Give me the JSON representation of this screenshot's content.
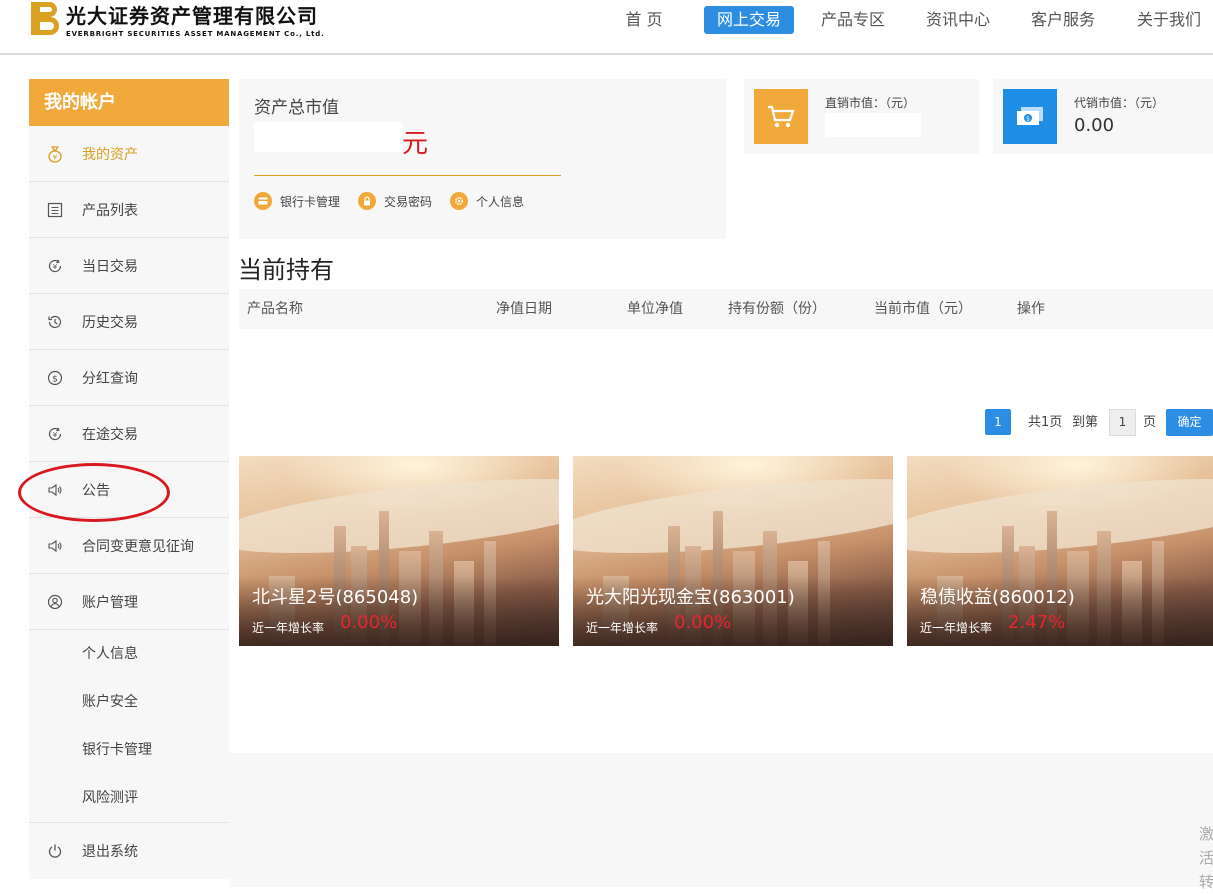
{
  "header": {
    "logo_cn": "光大证券资产管理有限公司",
    "logo_en": "EVERBRIGHT SECURITIES ASSET MANAGEMENT Co., Ltd.",
    "nav": [
      "首 页",
      "网上交易",
      "产品专区",
      "资讯中心",
      "客户服务",
      "关于我们"
    ],
    "active_nav": "网上交易",
    "accent_color": "#2d8de3"
  },
  "sidebar": {
    "title": "我的帐户",
    "title_color": "#f2a93b",
    "items": [
      {
        "label": "我的资产",
        "icon": "moneybag-icon",
        "active": true
      },
      {
        "label": "产品列表",
        "icon": "list-icon"
      },
      {
        "label": "当日交易",
        "icon": "yuan-refresh-icon"
      },
      {
        "label": "历史交易",
        "icon": "history-icon"
      },
      {
        "label": "分红查询",
        "icon": "dollar-circle-icon"
      },
      {
        "label": "在途交易",
        "icon": "yuan-refresh-icon"
      },
      {
        "label": "公告",
        "icon": "speaker-icon"
      },
      {
        "label": "合同变更意见征询",
        "icon": "speaker-icon"
      },
      {
        "label": "账户管理",
        "icon": "user-circle-icon"
      }
    ],
    "sub_items": [
      "个人信息",
      "账户安全",
      "银行卡管理",
      "风险测评"
    ],
    "logout": {
      "label": "退出系统",
      "icon": "power-icon"
    }
  },
  "assets": {
    "title": "资产总市值",
    "unit": "元",
    "links": [
      {
        "label": "银行卡管理",
        "icon": "card-icon"
      },
      {
        "label": "交易密码",
        "icon": "lock-icon"
      },
      {
        "label": "个人信息",
        "icon": "gear-icon"
      }
    ],
    "direct": {
      "label": "直销市值：（元）",
      "icon": "cart-icon"
    },
    "agency": {
      "label": "代销市值：（元）",
      "value": "0.00",
      "icon": "cash-icon"
    }
  },
  "holdings": {
    "title": "当前持有",
    "columns": [
      "产品名称",
      "净值日期",
      "单位净值",
      "持有份额（份）",
      "当前市值（元）",
      "操作"
    ]
  },
  "pager": {
    "current": "1",
    "total_text": "共1页",
    "goto_text": "到第",
    "goto_value": "1",
    "page_suffix": "页",
    "confirm": "确定"
  },
  "products": [
    {
      "name": "北斗星2号(865048)",
      "rate_label": "近一年增长率",
      "rate": "0.00%"
    },
    {
      "name": "光大阳光现金宝(863001)",
      "rate_label": "近一年增长率",
      "rate": "0.00%"
    },
    {
      "name": "稳债收益(860012)",
      "rate_label": "近一年增长率",
      "rate": "2.47%"
    }
  ],
  "edge_text": "激活转"
}
